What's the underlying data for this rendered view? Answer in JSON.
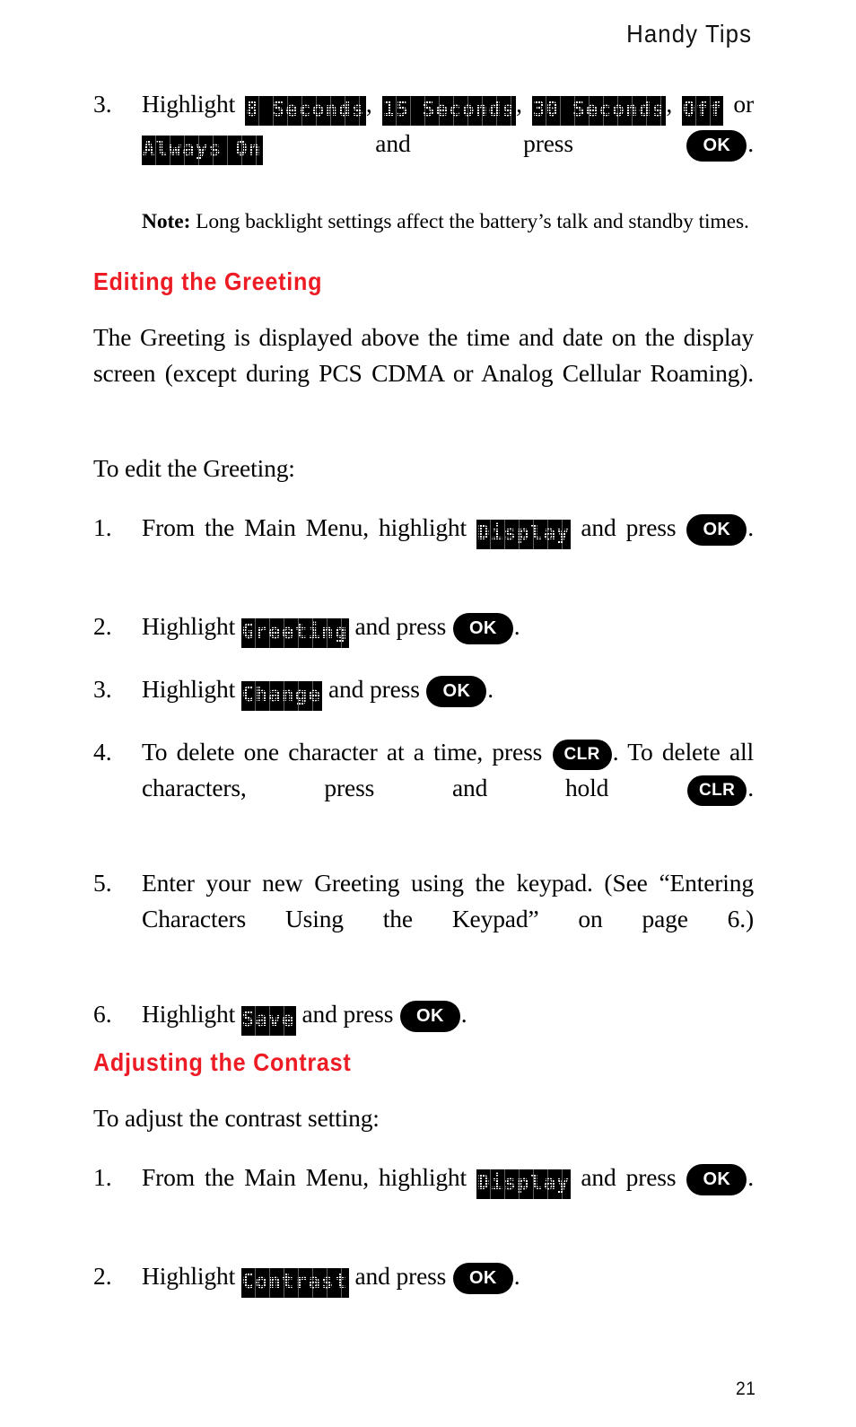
{
  "page": {
    "running_head": "Handy Tips",
    "folio": "21"
  },
  "keys": {
    "ok": "OK",
    "clr": "CLR"
  },
  "section_backlight": {
    "step3": {
      "number": "3.",
      "text_before": "Highlight ",
      "options": [
        "8 Seconds",
        "15 Seconds",
        "30 Seconds",
        "Off",
        "Always On"
      ],
      "separator_comma": ", ",
      "separator_or": " or ",
      "text_after": " and press ",
      "period": "."
    },
    "note": {
      "label": "Note:",
      "text": " Long backlight settings affect the battery’s talk and standby times."
    }
  },
  "section_greeting": {
    "heading": "Editing the Greeting",
    "paragraph": "The Greeting is displayed above the time and date on the display screen (except during PCS CDMA or Analog Cellular Roaming).",
    "lead_in": "To edit the Greeting:",
    "steps": [
      {
        "number": "1.",
        "before": "From the Main Menu, highlight ",
        "lcd": "Display",
        "middle": " and press ",
        "key": "OK",
        "after": "."
      },
      {
        "number": "2.",
        "before": "Highlight ",
        "lcd": "Greeting",
        "middle": " and press ",
        "key": "OK",
        "after": "."
      },
      {
        "number": "3.",
        "before": "Highlight ",
        "lcd": "Change",
        "middle": " and press ",
        "key": "OK",
        "after": "."
      },
      {
        "number": "4.",
        "before": "To delete one character at a time, press ",
        "key": "CLR",
        "middle": ". To delete all characters, press and hold ",
        "key2": "CLR",
        "after": "."
      },
      {
        "number": "5.",
        "text": "Enter your new Greeting using the keypad. (See “Entering Characters Using the Keypad” on page 6.)"
      },
      {
        "number": "6.",
        "before": "Highlight ",
        "lcd": "Save",
        "middle": " and press ",
        "key": "OK",
        "after": "."
      }
    ]
  },
  "section_contrast": {
    "heading": "Adjusting the Contrast",
    "lead_in": "To adjust the contrast setting:",
    "steps": [
      {
        "number": "1.",
        "before": "From the Main Menu, highlight ",
        "lcd": "Display",
        "middle": " and press ",
        "key": "OK",
        "after": "."
      },
      {
        "number": "2.",
        "before": "Highlight ",
        "lcd": "Contrast",
        "middle": " and press ",
        "key": "OK",
        "after": "."
      }
    ]
  },
  "colors": {
    "heading_red": "#ED1B24",
    "text_black": "#000000",
    "page_bg": "#FFFFFF"
  }
}
